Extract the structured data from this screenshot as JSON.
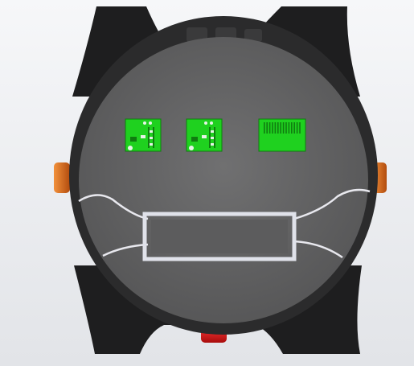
{
  "colors": {
    "background_top": "#f6f7f9",
    "background_bottom": "#e2e4e8",
    "strap": "#1e1e1f",
    "bezel": "#2b2b2c",
    "dial_center": "#707071",
    "dial_edge": "#555556",
    "pcb_green": "#1fd11f",
    "pcb_dark_green": "#0f7d0f",
    "pcb_white": "#e8f4e8",
    "display_frame": "#e0e2ea",
    "display_glass": "#5c5c5d",
    "side_button": "#d9661c",
    "bottom_button": "#e51717",
    "wire": "#e8e8ee"
  },
  "components": {
    "pcb_modules": 3,
    "side_buttons": 2,
    "bottom_buttons": 1
  }
}
